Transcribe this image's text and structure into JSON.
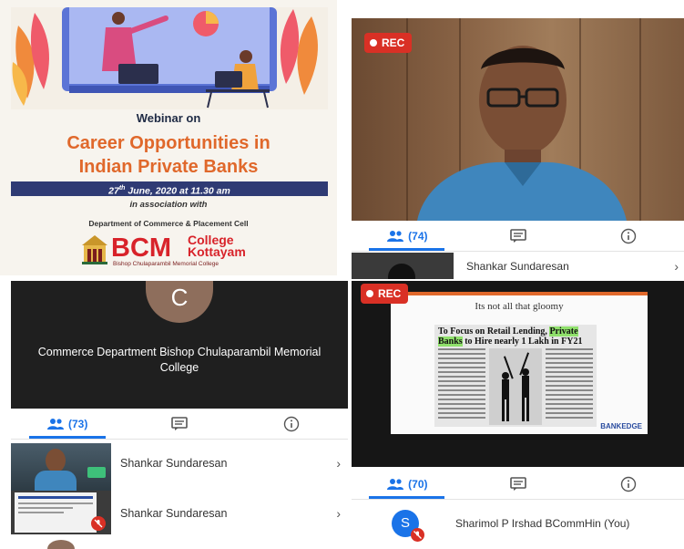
{
  "poster": {
    "webinar_label": "Webinar on",
    "title_line1": "Career Opportunities in",
    "title_line2": "Indian Private Banks",
    "date_prefix": "27",
    "date_sup": "th",
    "date_rest": " June, 2020 at 11.30 am",
    "association": "in association with",
    "department": "Department of Commerce & Placement Cell",
    "logo_bcm": "BCM",
    "logo_college": "College",
    "logo_kottayam": "Kottayam",
    "logo_sub": "Bishop Chulaparambil Memorial College"
  },
  "call_top_right": {
    "rec_label": "REC",
    "participants_count": "(74)",
    "participant_name": "Shankar Sundaresan"
  },
  "call_bottom_left": {
    "avatar_letter": "C",
    "caption": "Commerce Department Bishop Chulaparambil Memorial College",
    "participants_count": "(73)",
    "participants": [
      {
        "name": "Shankar Sundaresan"
      },
      {
        "name": "Shankar Sundaresan"
      }
    ]
  },
  "call_bottom_right": {
    "rec_label": "REC",
    "slide_title": "Its not all that gloomy",
    "headline_part1": "To Focus on Retail Lending, ",
    "headline_highlight1": "Private",
    "headline_highlight2": "Banks",
    "headline_part2": " to Hire nearly 1 Lakh in FY21",
    "slide_brand": "BANKEDGE",
    "participants_count": "(70)",
    "self_avatar": "S",
    "self_name": "Sharimol P Irshad BCommHin (You)"
  },
  "colors": {
    "accent_blue": "#1a73e8",
    "rec_red": "#d93025",
    "title_orange": "#e0682b",
    "logo_red": "#d8232a"
  },
  "icons": [
    "people-icon",
    "chat-icon",
    "info-icon",
    "chevron-right-icon",
    "mic-off-icon"
  ]
}
